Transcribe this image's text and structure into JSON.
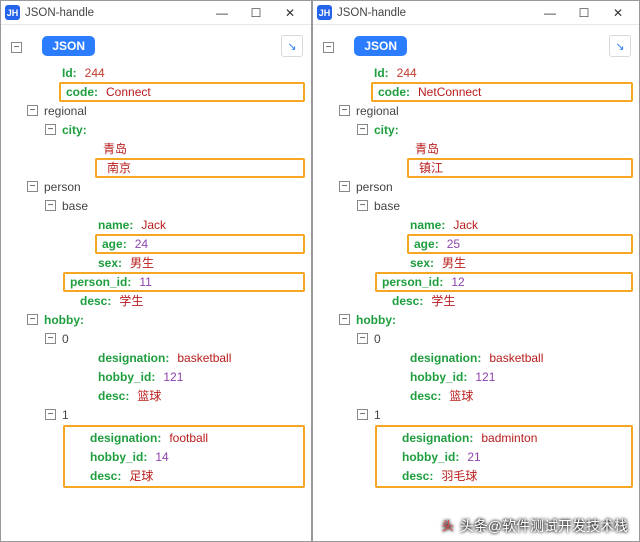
{
  "app_icon_text": "JH",
  "window_title": "JSON-handle",
  "root_label": "JSON",
  "win_controls": {
    "min": "—",
    "max": "☐",
    "close": "✕"
  },
  "arrow_glyph": "↘",
  "toggle_minus": "−",
  "caption": "头条@软件测试开发技术栈",
  "left": {
    "Id": "244",
    "code": "Connect",
    "regional_key": "regional",
    "city_key": "city",
    "city0": "青岛",
    "city1": "南京",
    "person_key": "person",
    "base_key": "base",
    "name_k": "name",
    "name_v": "Jack",
    "age_k": "age",
    "age_v": "24",
    "sex_k": "sex",
    "sex_v": "男生",
    "pid_k": "person_id",
    "pid_v": "11",
    "desc_k": "desc",
    "desc_v": "学生",
    "hobby_key": "hobby",
    "h0_idx": "0",
    "h0_des_k": "designation",
    "h0_des_v": "basketball",
    "h0_id_k": "hobby_id",
    "h0_id_v": "121",
    "h0_dc_k": "desc",
    "h0_dc_v": "篮球",
    "h1_idx": "1",
    "h1_des_k": "designation",
    "h1_des_v": "football",
    "h1_id_k": "hobby_id",
    "h1_id_v": "14",
    "h1_dc_k": "desc",
    "h1_dc_v": "足球"
  },
  "right": {
    "Id": "244",
    "code": "NetConnect",
    "regional_key": "regional",
    "city_key": "city",
    "city0": "青岛",
    "city1": "镇江",
    "person_key": "person",
    "base_key": "base",
    "name_k": "name",
    "name_v": "Jack",
    "age_k": "age",
    "age_v": "25",
    "sex_k": "sex",
    "sex_v": "男生",
    "pid_k": "person_id",
    "pid_v": "12",
    "desc_k": "desc",
    "desc_v": "学生",
    "hobby_key": "hobby",
    "h0_idx": "0",
    "h0_des_k": "designation",
    "h0_des_v": "basketball",
    "h0_id_k": "hobby_id",
    "h0_id_v": "121",
    "h0_dc_k": "desc",
    "h0_dc_v": "篮球",
    "h1_idx": "1",
    "h1_des_k": "designation",
    "h1_des_v": "badminton",
    "h1_id_k": "hobby_id",
    "h1_id_v": "21",
    "h1_dc_k": "desc",
    "h1_dc_v": "羽毛球"
  }
}
